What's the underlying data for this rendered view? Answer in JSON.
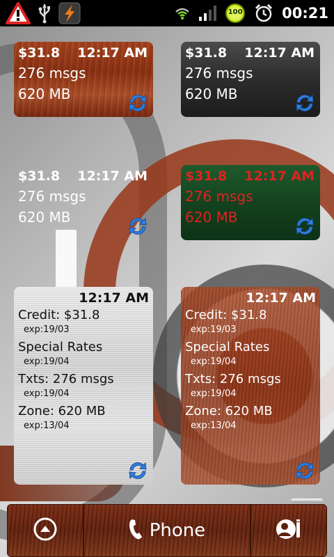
{
  "status_bar": {
    "time": "00:21",
    "battery_level": "100",
    "icons": [
      "warning-icon",
      "usb-icon",
      "flash-app-icon",
      "wifi-icon",
      "signal-icon",
      "battery-icon",
      "alarm-icon"
    ]
  },
  "widgets": {
    "w1": {
      "amount": "$31.8",
      "time": "12:17 AM",
      "msgs": "276 msgs",
      "data": "620 MB"
    },
    "w2": {
      "amount": "$31.8",
      "time": "12:17 AM",
      "msgs": "276 msgs",
      "data": "620 MB"
    },
    "w3": {
      "amount": "$31.8",
      "time": "12:17 AM",
      "msgs": "276 msgs",
      "data": "620 MB"
    },
    "w4": {
      "amount": "$31.8",
      "time": "12:17 AM",
      "msgs": "276 msgs",
      "data": "620 MB"
    },
    "big1": {
      "time": "12:17 AM",
      "items": [
        {
          "label": "Credit: $31.8",
          "exp": "exp:19/03"
        },
        {
          "label": "Special Rates",
          "exp": "exp:19/04"
        },
        {
          "label": "Txts: 276 msgs",
          "exp": "exp:19/04"
        },
        {
          "label": "Zone: 620 MB",
          "exp": "exp:13/04"
        }
      ]
    },
    "big2": {
      "time": "12:17 AM",
      "items": [
        {
          "label": "Credit: $31.8",
          "exp": "exp:19/03"
        },
        {
          "label": "Special Rates",
          "exp": "exp:19/04"
        },
        {
          "label": "Txts: 276 msgs",
          "exp": "exp:19/04"
        },
        {
          "label": "Zone: 620 MB",
          "exp": "exp:13/04"
        }
      ]
    }
  },
  "dock": {
    "phone_label": "Phone"
  },
  "colors": {
    "wood": "#8e3213",
    "green": "#14421e",
    "alert_red": "#e02222",
    "sync_blue": "#2f7fe0"
  }
}
